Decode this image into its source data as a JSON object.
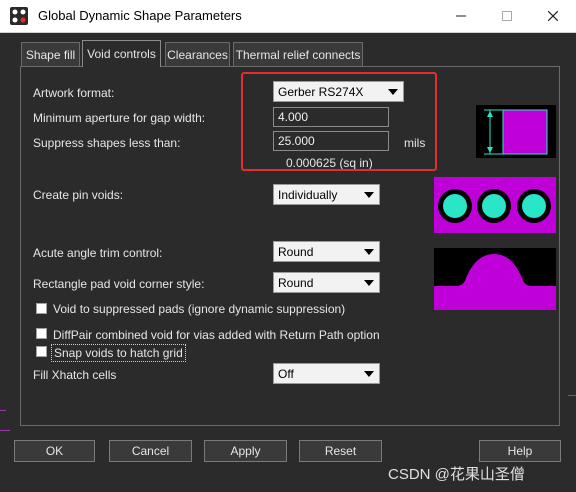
{
  "window": {
    "title": "Global Dynamic Shape Parameters"
  },
  "tabs": [
    {
      "label": "Shape fill"
    },
    {
      "label": "Void controls"
    },
    {
      "label": "Clearances"
    },
    {
      "label": "Thermal relief connects"
    }
  ],
  "form": {
    "artwork_format_label": "Artwork format:",
    "artwork_format_value": "Gerber RS274X",
    "min_aperture_label": "Minimum aperture for gap width:",
    "min_aperture_value": "4.000",
    "suppress_label": "Suppress shapes less than:",
    "suppress_value": "25.000",
    "suppress_unit": "mils",
    "suppress_area": "0.000625 (sq in)",
    "pin_voids_label": "Create pin voids:",
    "pin_voids_value": "Individually",
    "acute_label": "Acute angle trim control:",
    "acute_value": "Round",
    "rect_pad_label": "Rectangle pad void corner style:",
    "rect_pad_value": "Round",
    "void_suppressed_label": "Void to suppressed pads (ignore dynamic suppression)",
    "diffpair_label": "DiffPair combined void for vias added with Return Path option",
    "snap_label": "Snap voids to hatch grid",
    "xhatch_label": "Fill Xhatch cells",
    "xhatch_value": "Off"
  },
  "buttons": {
    "ok": "OK",
    "cancel": "Cancel",
    "apply": "Apply",
    "reset": "Reset",
    "help": "Help"
  },
  "watermark": "CSDN @花果山圣僧",
  "colors": {
    "accent_magenta": "#c000d8",
    "pad_cyan": "#29e6c8",
    "highlight_red": "#e52d2d"
  }
}
